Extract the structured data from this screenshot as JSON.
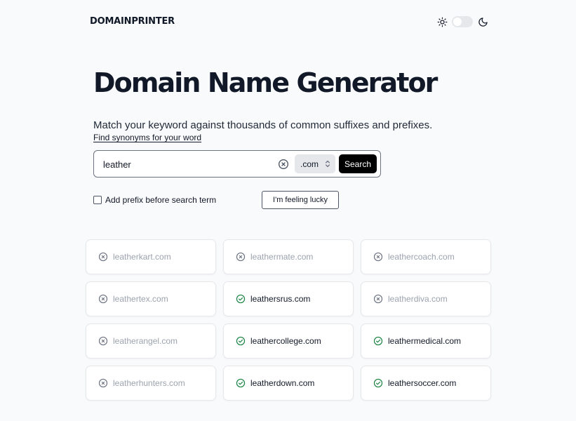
{
  "header": {
    "logo": "DOMAINPRINTER",
    "theme_icons": {
      "light": "sun-icon",
      "dark": "moon-icon"
    },
    "dark_mode": false
  },
  "hero": {
    "title": "Domain Name Generator",
    "subtitle": "Match your keyword against thousands of common suffixes and prefixes.",
    "synonyms_link": "Find synonyms for your word"
  },
  "search": {
    "value": "leather",
    "tld": ".com",
    "search_label": "Search",
    "clear_icon": "x-circle-icon"
  },
  "options": {
    "prefix_label": "Add prefix before search term",
    "prefix_checked": false,
    "lucky_label": "I'm feeling lucky"
  },
  "colors": {
    "available": "#15803d",
    "taken": "#9ca3af",
    "primary_button": "#000000",
    "background": "#f9fafb"
  },
  "results": [
    {
      "name": "leatherkart.com",
      "available": false
    },
    {
      "name": "leathermate.com",
      "available": false
    },
    {
      "name": "leathercoach.com",
      "available": false
    },
    {
      "name": "leathertex.com",
      "available": false
    },
    {
      "name": "leathersrus.com",
      "available": true
    },
    {
      "name": "leatherdiva.com",
      "available": false
    },
    {
      "name": "leatherangel.com",
      "available": false
    },
    {
      "name": "leathercollege.com",
      "available": true
    },
    {
      "name": "leathermedical.com",
      "available": true
    },
    {
      "name": "leatherhunters.com",
      "available": false
    },
    {
      "name": "leatherdown.com",
      "available": true
    },
    {
      "name": "leathersoccer.com",
      "available": true
    }
  ]
}
